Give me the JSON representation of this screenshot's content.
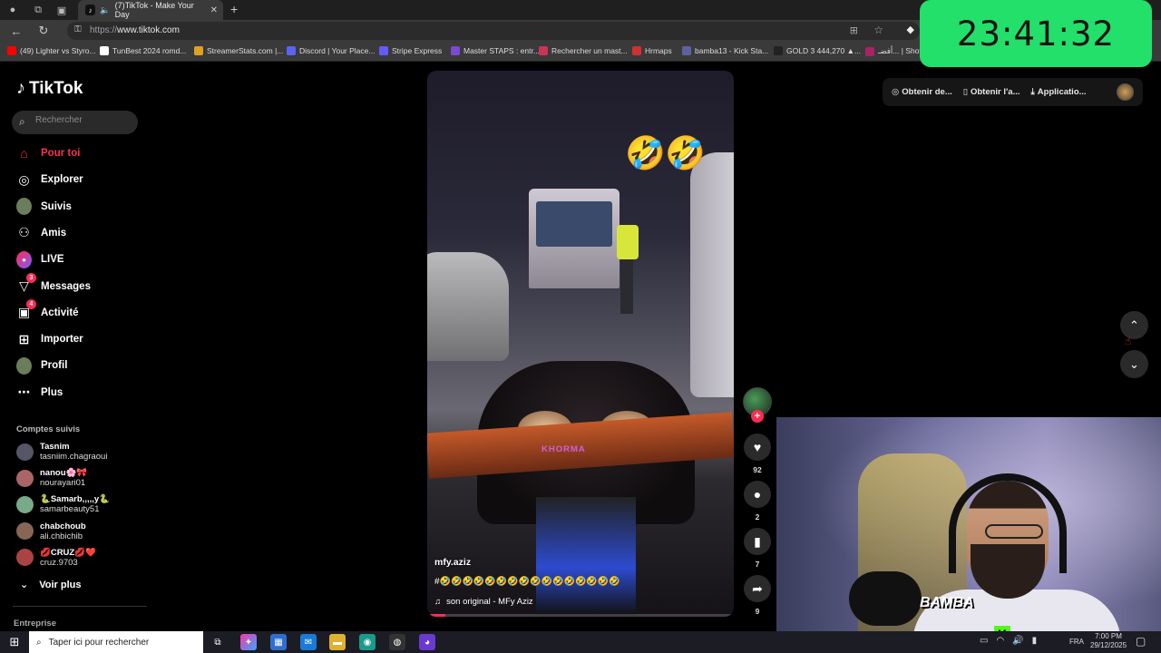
{
  "browser": {
    "tab_title": "(7)TikTok - Make Your Day",
    "url_scheme": "https://",
    "url_host": "www.tiktok.com",
    "bookmarks": [
      {
        "label": "(49) Lighter vs Styro...",
        "color": "#ff0000"
      },
      {
        "label": "TunBest 2024 romd...",
        "color": "#ffffff"
      },
      {
        "label": "StreamerStats.com |...",
        "color": "#e0a020"
      },
      {
        "label": "Discord | Your Place...",
        "color": "#5865f2"
      },
      {
        "label": "Stripe Express",
        "color": "#635bff"
      },
      {
        "label": "Master STAPS : entr...",
        "color": "#7a4ad0"
      },
      {
        "label": "Rechercher un mast...",
        "color": "#cc3355"
      },
      {
        "label": "Hrmaps",
        "color": "#d03030"
      },
      {
        "label": "bamba13 - Kick Sta...",
        "color": "#6060a0"
      },
      {
        "label": "GOLD 3 444,270 ▲...",
        "color": "#222222"
      },
      {
        "label": "أفضـ... | Shofha",
        "color": "#aa2266"
      }
    ]
  },
  "clock": "23:41:32",
  "tiktok": {
    "logo_text": "TikTok",
    "search_placeholder": "Rechercher",
    "nav": [
      {
        "label": "Pour toi",
        "icon": "home-icon",
        "active": true
      },
      {
        "label": "Explorer",
        "icon": "compass-icon"
      },
      {
        "label": "Suivis",
        "icon": "avatar"
      },
      {
        "label": "Amis",
        "icon": "friends-icon"
      },
      {
        "label": "LIVE",
        "icon": "live-icon"
      },
      {
        "label": "Messages",
        "icon": "messages-icon",
        "badge": "3"
      },
      {
        "label": "Activité",
        "icon": "activity-icon",
        "badge": "4"
      },
      {
        "label": "Importer",
        "icon": "upload-icon"
      },
      {
        "label": "Profil",
        "icon": "avatar"
      },
      {
        "label": "Plus",
        "icon": "more-icon"
      }
    ],
    "following_title": "Comptes suivis",
    "following": [
      {
        "name": "Tasnim",
        "user": "tasniim.chagraoui"
      },
      {
        "name": "nanou🌸🎀",
        "user": "nourayari01"
      },
      {
        "name": "🐍Samarb,,,,,y🐍",
        "user": "samarbeauty51"
      },
      {
        "name": "chabchoub",
        "user": "ali.chbichib"
      },
      {
        "name": "💋CRUZ💋❤️",
        "user": "cruz.9703"
      }
    ],
    "see_more": "Voir plus",
    "footer_section": "Entreprise",
    "top_actions": [
      "Obtenir de...",
      "Obtenir l'a...",
      "Applicatio..."
    ],
    "video": {
      "username": "mfy.aziz",
      "caption": "#🤣🤣🤣🤣🤣🤣🤣🤣🤣🤣🤣🤣🤣🤣🤣🤣",
      "sound": "son original - MFy Aziz",
      "watermark": "KHORMA",
      "progress": 0.06
    },
    "actions": {
      "likes": "92",
      "comments": "2",
      "saves": "7",
      "shares": "9"
    }
  },
  "taskbar": {
    "search_placeholder": "Taper ici pour rechercher",
    "lang": "FRA",
    "time": "7:00 PM",
    "date": "29/12/2025"
  },
  "stream_logo": "BAMBA"
}
